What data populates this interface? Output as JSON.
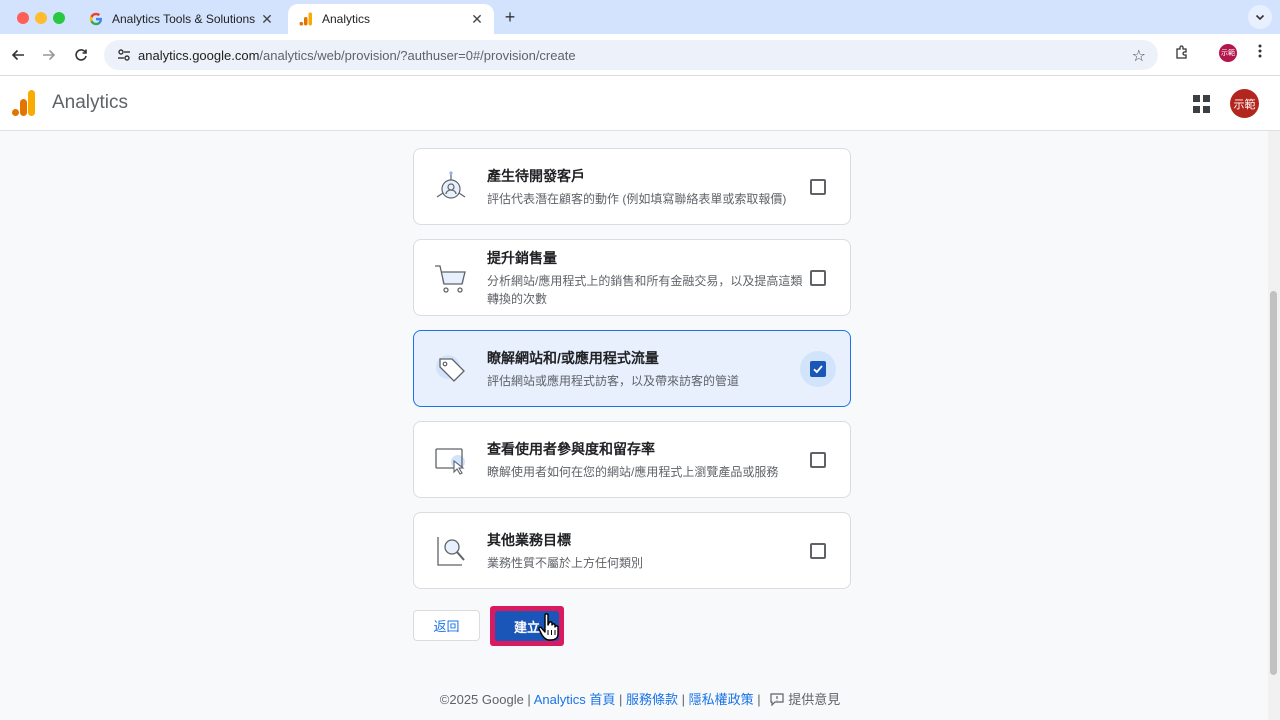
{
  "browser": {
    "tabs": [
      {
        "title": "Analytics Tools & Solutions fo",
        "icon": "google-g-icon",
        "active": false
      },
      {
        "title": "Analytics",
        "icon": "analytics-logo-icon",
        "active": true
      }
    ],
    "close_glyph": "✕",
    "new_tab_glyph": "+",
    "url_host": "analytics.google.com",
    "url_path": "/analytics/web/provision/?authuser=0#/provision/create",
    "profile_initials": "示範"
  },
  "app": {
    "name": "Analytics",
    "avatar_initials": "示範"
  },
  "options": [
    {
      "title": "產生待開發客戶",
      "desc": "評估代表潛在顧客的動作 (例如填寫聯絡表單或索取報價)",
      "icon": "leads-icon",
      "checked": false
    },
    {
      "title": "提升銷售量",
      "desc": "分析網站/應用程式上的銷售和所有金融交易，以及提高這類轉換的次數",
      "icon": "shopping-cart-icon",
      "checked": false
    },
    {
      "title": "瞭解網站和/或應用程式流量",
      "desc": "評估網站或應用程式訪客，以及帶來訪客的管道",
      "icon": "tag-icon",
      "checked": true
    },
    {
      "title": "查看使用者參與度和留存率",
      "desc": "瞭解使用者如何在您的網站/應用程式上瀏覽產品或服務",
      "icon": "screen-cursor-icon",
      "checked": false
    },
    {
      "title": "其他業務目標",
      "desc": "業務性質不屬於上方任何類別",
      "icon": "magnifier-icon",
      "checked": false
    }
  ],
  "buttons": {
    "back": "返回",
    "create": "建立"
  },
  "footer": {
    "copyright": "©2025 Google | ",
    "home": "Analytics 首頁",
    "sep1": " | ",
    "terms": "服務條款",
    "sep2": " | ",
    "privacy": "隱私權政策",
    "sep3": " | ",
    "feedback": "提供意見"
  },
  "colors": {
    "accent": "#1a73e8",
    "selected_bg": "#e8f0fe",
    "create_button": "#1a56b8",
    "highlight": "#d81b60"
  }
}
